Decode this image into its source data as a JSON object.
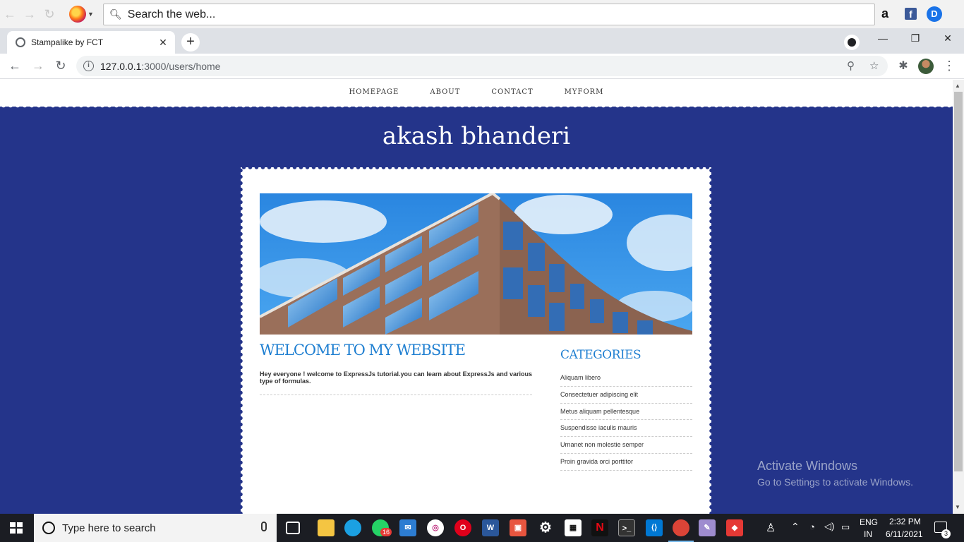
{
  "top_toolbar": {
    "search_placeholder": "Search the web..."
  },
  "browser": {
    "tab_title": "Stampalike by FCT",
    "tab_close": "✕",
    "new_tab": "+",
    "url_host": "127.0.0.1",
    "url_rest": ":3000/users/home"
  },
  "site": {
    "nav": [
      "HOMEPAGE",
      "ABOUT",
      "CONTACT",
      "MYFORM"
    ],
    "title": "akash bhanderi",
    "welcome": "WELCOME TO MY WEBSITE",
    "intro": "Hey everyone ! welcome to ExpressJs tutorial.you can learn about ExpressJs and various type of formulas.",
    "categories_title": "CATEGORIES",
    "categories": [
      "Aliquam libero",
      "Consectetuer adipiscing elit",
      "Metus aliquam pellentesque",
      "Suspendisse iaculis mauris",
      "Urnanet non molestie semper",
      "Proin gravida orci porttitor"
    ],
    "colors": {
      "background": "#24348a",
      "heading": "#1f7fd1"
    }
  },
  "watermark": {
    "line1": "Activate Windows",
    "line2": "Go to Settings to activate Windows."
  },
  "taskbar": {
    "search_placeholder": "Type here to search",
    "whatsapp_badge": "16",
    "lang_1": "ENG",
    "lang_2": "IN",
    "time": "2:32 PM",
    "date": "6/11/2021",
    "notification_count": "3"
  }
}
